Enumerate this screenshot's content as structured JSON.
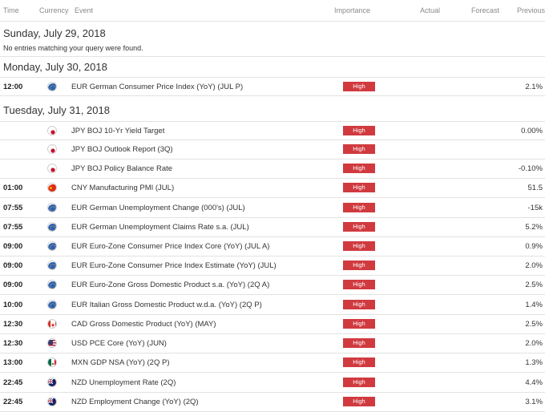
{
  "header": {
    "time": "Time",
    "currency": "Currency",
    "event": "Event",
    "importance": "Importance",
    "actual": "Actual",
    "forecast": "Forecast",
    "previous": "Previous"
  },
  "days": [
    {
      "title": "Sunday, July 29, 2018",
      "note": "No entries matching your query were found."
    },
    {
      "title": "Monday, July 30, 2018"
    },
    {
      "title": "Tuesday, July 31, 2018"
    }
  ],
  "rows": [
    {
      "time": "12:00",
      "flag": "EU",
      "event": "EUR German Consumer Price Index (YoY) (JUL P)",
      "importance": "High",
      "actual": "",
      "forecast": "",
      "previous": "2.1%"
    },
    {
      "time": "",
      "flag": "JP",
      "event": "JPY BOJ 10-Yr Yield Target",
      "importance": "High",
      "actual": "",
      "forecast": "",
      "previous": "0.00%"
    },
    {
      "time": "",
      "flag": "JP",
      "event": "JPY BOJ Outlook Report (3Q)",
      "importance": "High",
      "actual": "",
      "forecast": "",
      "previous": ""
    },
    {
      "time": "",
      "flag": "JP",
      "event": "JPY BOJ Policy Balance Rate",
      "importance": "High",
      "actual": "",
      "forecast": "",
      "previous": "-0.10%"
    },
    {
      "time": "01:00",
      "flag": "CN",
      "event": "CNY Manufacturing PMI (JUL)",
      "importance": "High",
      "actual": "",
      "forecast": "",
      "previous": "51.5"
    },
    {
      "time": "07:55",
      "flag": "EU",
      "event": "EUR German Unemployment Change (000's) (JUL)",
      "importance": "High",
      "actual": "",
      "forecast": "",
      "previous": "-15k"
    },
    {
      "time": "07:55",
      "flag": "EU",
      "event": "EUR German Unemployment Claims Rate s.a. (JUL)",
      "importance": "High",
      "actual": "",
      "forecast": "",
      "previous": "5.2%"
    },
    {
      "time": "09:00",
      "flag": "EU",
      "event": "EUR Euro-Zone Consumer Price Index Core (YoY) (JUL A)",
      "importance": "High",
      "actual": "",
      "forecast": "",
      "previous": "0.9%"
    },
    {
      "time": "09:00",
      "flag": "EU",
      "event": "EUR Euro-Zone Consumer Price Index Estimate (YoY) (JUL)",
      "importance": "High",
      "actual": "",
      "forecast": "",
      "previous": "2.0%"
    },
    {
      "time": "09:00",
      "flag": "EU",
      "event": "EUR Euro-Zone Gross Domestic Product s.a. (YoY) (2Q A)",
      "importance": "High",
      "actual": "",
      "forecast": "",
      "previous": "2.5%"
    },
    {
      "time": "10:00",
      "flag": "EU",
      "event": "EUR Italian Gross Domestic Product w.d.a. (YoY) (2Q P)",
      "importance": "High",
      "actual": "",
      "forecast": "",
      "previous": "1.4%"
    },
    {
      "time": "12:30",
      "flag": "CA",
      "event": "CAD Gross Domestic Product (YoY) (MAY)",
      "importance": "High",
      "actual": "",
      "forecast": "",
      "previous": "2.5%"
    },
    {
      "time": "12:30",
      "flag": "US",
      "event": "USD PCE Core (YoY) (JUN)",
      "importance": "High",
      "actual": "",
      "forecast": "",
      "previous": "2.0%"
    },
    {
      "time": "13:00",
      "flag": "MX",
      "event": "MXN GDP NSA (YoY) (2Q P)",
      "importance": "High",
      "actual": "",
      "forecast": "",
      "previous": "1.3%"
    },
    {
      "time": "22:45",
      "flag": "NZ",
      "event": "NZD Unemployment Rate (2Q)",
      "importance": "High",
      "actual": "",
      "forecast": "",
      "previous": "4.4%"
    },
    {
      "time": "22:45",
      "flag": "NZ",
      "event": "NZD Employment Change (YoY) (2Q)",
      "importance": "High",
      "actual": "",
      "forecast": "",
      "previous": "3.1%"
    }
  ],
  "colors": {
    "importance_high": "#d03a3f",
    "header_text": "#8a8a8a",
    "row_border": "#e2e2e2"
  }
}
